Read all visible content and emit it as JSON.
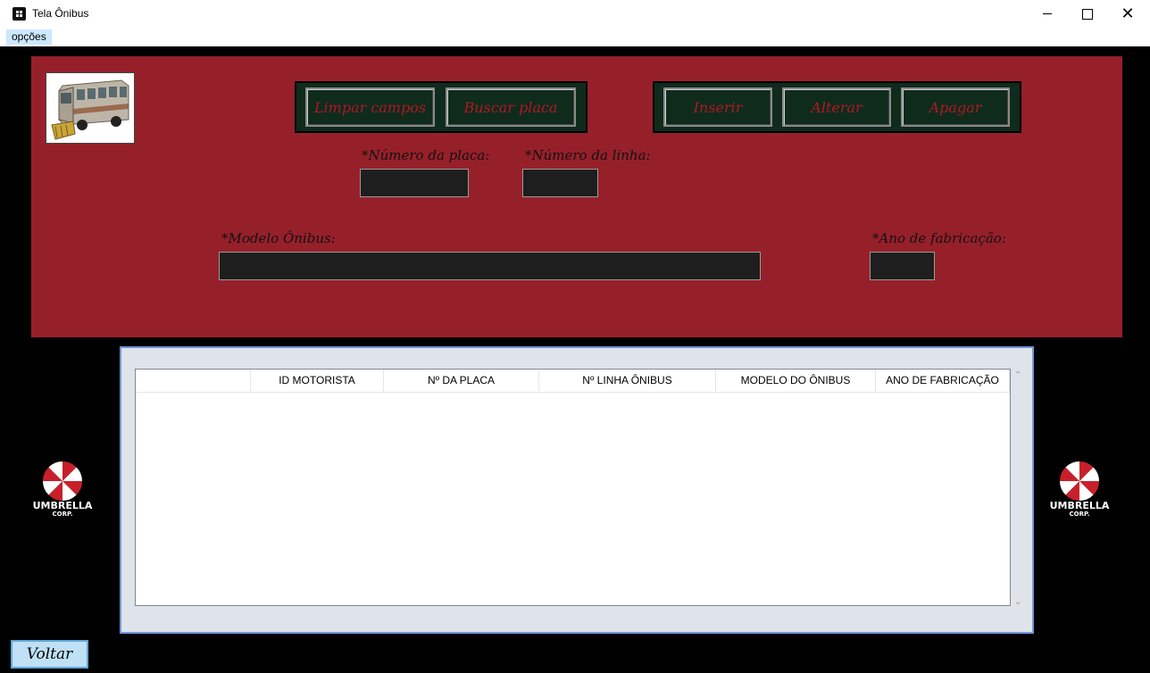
{
  "window": {
    "title": "Tela Ônibus"
  },
  "menu": {
    "items": [
      {
        "label": "opções"
      }
    ]
  },
  "toolbar": {
    "limpar_label": "Limpar campos",
    "buscar_label": "Buscar placa",
    "inserir_label": "Inserir",
    "alterar_label": "Alterar",
    "apagar_label": "Apagar"
  },
  "form": {
    "placa_label": "*Número da placa:",
    "placa_value": "",
    "linha_label": "*Número da linha:",
    "linha_value": "",
    "modelo_label": "*Modelo Ônibus:",
    "modelo_value": "",
    "ano_label": "*Ano de fabricação:",
    "ano_value": ""
  },
  "table": {
    "columns": [
      "",
      "ID MOTORISTA",
      "Nº DA PLACA",
      "Nº LINHA ÔNIBUS",
      "MODELO DO ÔNIBUS",
      "ANO DE FABRICAÇÃO"
    ],
    "rows": []
  },
  "logo": {
    "brand": "UMBRELLA",
    "sub": "CORP.",
    "colors": {
      "red": "#c8202a",
      "white": "#ffffff"
    }
  },
  "footer": {
    "voltar_label": "Voltar"
  },
  "colors": {
    "panel_red": "#96202a",
    "button_bg": "#0f2b1c",
    "button_text": "#b01824",
    "field_bg": "#1e1e1e"
  }
}
